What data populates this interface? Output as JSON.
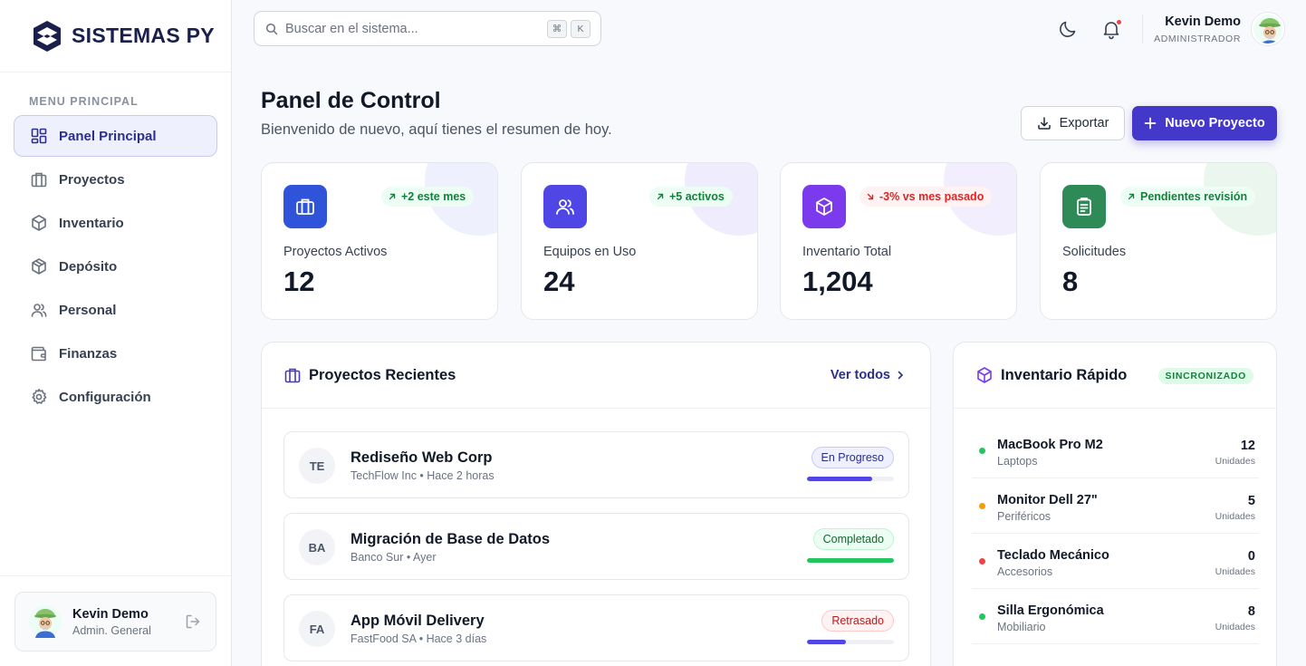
{
  "brand": {
    "name": "SISTEMAS PY"
  },
  "sidebar": {
    "heading": "MENU PRINCIPAL",
    "items": [
      {
        "label": "Panel Principal",
        "icon": "grid-icon",
        "active": true
      },
      {
        "label": "Proyectos",
        "icon": "briefcase-icon"
      },
      {
        "label": "Inventario",
        "icon": "box-icon"
      },
      {
        "label": "Depósito",
        "icon": "package-icon"
      },
      {
        "label": "Personal",
        "icon": "users-icon"
      },
      {
        "label": "Finanzas",
        "icon": "wallet-icon"
      },
      {
        "label": "Configuración",
        "icon": "gear-icon"
      }
    ],
    "user": {
      "name": "Kevin Demo",
      "role": "Admin. General"
    }
  },
  "header": {
    "search_placeholder": "Buscar en el sistema...",
    "shortcut_keys": [
      "⌘",
      "K"
    ],
    "user": {
      "name": "Kevin Demo",
      "role": "ADMINISTRADOR"
    }
  },
  "page": {
    "title": "Panel de Control",
    "subtitle": "Bienvenido de nuevo, aquí tienes el resumen de hoy.",
    "export_label": "Exportar",
    "new_project_label": "Nuevo Proyecto"
  },
  "stats": [
    {
      "label": "Proyectos Activos",
      "value": "12",
      "badge": "+2 este mes",
      "trend": "up",
      "icon": "briefcase-icon",
      "color": "#2f54d9"
    },
    {
      "label": "Equipos en Uso",
      "value": "24",
      "badge": "+5 activos",
      "trend": "up",
      "icon": "users-icon",
      "color": "#4f46e5"
    },
    {
      "label": "Inventario Total",
      "value": "1,204",
      "badge": "-3% vs mes pasado",
      "trend": "down",
      "icon": "box-icon",
      "color": "#7c3aed"
    },
    {
      "label": "Solicitudes",
      "value": "8",
      "badge": "Pendientes revisión",
      "trend": "up",
      "icon": "clipboard-icon",
      "color": "#2e8b57"
    }
  ],
  "projects": {
    "title": "Proyectos Recientes",
    "view_all": "Ver todos",
    "items": [
      {
        "initials": "TE",
        "name": "Rediseño Web Corp",
        "meta": "TechFlow Inc • Hace 2 horas",
        "status": "En Progreso",
        "status_kind": "progress",
        "progress": 0.75
      },
      {
        "initials": "BA",
        "name": "Migración de Base de Datos",
        "meta": "Banco Sur • Ayer",
        "status": "Completado",
        "status_kind": "done",
        "progress": 1.0
      },
      {
        "initials": "FA",
        "name": "App Móvil Delivery",
        "meta": "FastFood SA • Hace 3 días",
        "status": "Retrasado",
        "status_kind": "late",
        "progress": 0.45
      }
    ]
  },
  "inventory": {
    "title": "Inventario Rápido",
    "sync_label": "SINCRONIZADO",
    "items": [
      {
        "name": "MacBook Pro M2",
        "category": "Laptops",
        "qty": "12",
        "unit": "Unidades",
        "dot": "#22c55e"
      },
      {
        "name": "Monitor Dell 27\"",
        "category": "Periféricos",
        "qty": "5",
        "unit": "Unidades",
        "dot": "#f59e0b"
      },
      {
        "name": "Teclado Mecánico",
        "category": "Accesorios",
        "qty": "0",
        "unit": "Unidades",
        "dot": "#ef4444"
      },
      {
        "name": "Silla Ergonómica",
        "category": "Mobiliario",
        "qty": "8",
        "unit": "Unidades",
        "dot": "#22c55e"
      }
    ]
  },
  "colors": {
    "accent": "#4338ca",
    "brand_dark": "#1a1f4b"
  }
}
